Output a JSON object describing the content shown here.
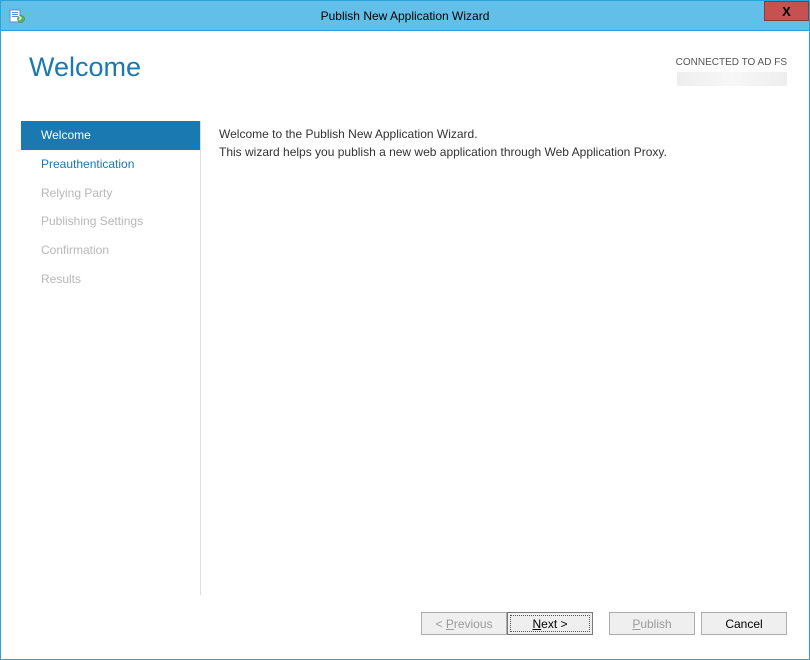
{
  "window": {
    "title": "Publish New Application Wizard"
  },
  "heading": "Welcome",
  "connection": {
    "label": "CONNECTED TO AD FS"
  },
  "steps": [
    {
      "label": "Welcome",
      "state": "active"
    },
    {
      "label": "Preauthentication",
      "state": "enabled"
    },
    {
      "label": "Relying Party",
      "state": "disabled"
    },
    {
      "label": "Publishing Settings",
      "state": "disabled"
    },
    {
      "label": "Confirmation",
      "state": "disabled"
    },
    {
      "label": "Results",
      "state": "disabled"
    }
  ],
  "body": {
    "line1": "Welcome to the Publish New Application Wizard.",
    "line2": "This wizard helps you publish a new web application through Web Application Proxy."
  },
  "buttons": {
    "previous_prefix": "< ",
    "previous_u": "P",
    "previous_rest": "revious",
    "next_u": "N",
    "next_rest": "ext >",
    "publish_u": "P",
    "publish_rest": "ublish",
    "cancel": "Cancel"
  }
}
